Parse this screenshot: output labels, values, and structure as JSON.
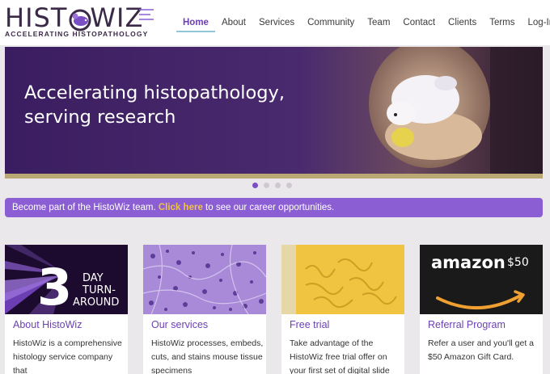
{
  "brand": {
    "logo_word_left": "HIST",
    "logo_word_right": "WIZ",
    "tagline": "ACCELERATING HISTOPATHOLOGY"
  },
  "nav": {
    "items": [
      {
        "label": "Home"
      },
      {
        "label": "About"
      },
      {
        "label": "Services"
      },
      {
        "label": "Community"
      },
      {
        "label": "Team"
      },
      {
        "label": "Contact"
      },
      {
        "label": "Clients"
      },
      {
        "label": "Terms"
      },
      {
        "label": "Log-In"
      }
    ],
    "active": "Home"
  },
  "hero": {
    "title_line1": "Accelerating histopathology,",
    "title_line2": "serving research",
    "slides_total": 4,
    "active_slide": 1
  },
  "career_banner": {
    "prefix": "Become part of the HistoWiz team. ",
    "link": "Click here",
    "suffix": " to see our career opportunities."
  },
  "cards": [
    {
      "image_text_big": "3",
      "image_text_small1": "DAY",
      "image_text_small2": "TURN-",
      "image_text_small3": "AROUND",
      "title": "About HistoWiz",
      "text": "HistoWiz is a comprehensive histology service company that"
    },
    {
      "title": "Our services",
      "text": "HistoWiz processes, embeds, cuts, and stains mouse tissue specimens"
    },
    {
      "title": "Free trial",
      "text": "Take advantage of the HistoWiz free trial offer on your first set of digital slide"
    },
    {
      "image_brand": "amazon",
      "image_amount": "$50",
      "title": "Referral Program",
      "text": "Refer a user and you'll get a $50 Amazon Gift Card."
    }
  ],
  "colors": {
    "accent": "#6b3fb3",
    "banner": "#8b5fd3",
    "link": "#f0c340",
    "hero_bg": "#3d1f63"
  },
  "icons": {
    "login": "login-icon"
  }
}
